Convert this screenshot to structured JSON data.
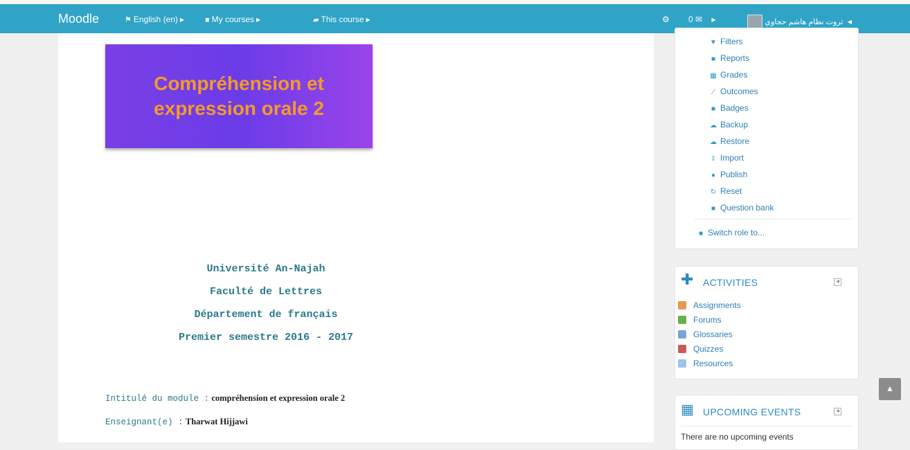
{
  "navbar": {
    "brand": "Moodle",
    "language": "English (en)",
    "my_courses": "My courses",
    "this_course": "This course",
    "messages_count": "0",
    "user_name": "ثروت نظام هاشم حجاوي"
  },
  "banner": {
    "line1": "Compréhension et",
    "line2": "expression orale 2"
  },
  "header_lines": [
    "Université An-Najah",
    "Faculté de Lettres",
    "Département de français",
    "Premier semestre  2016 - 2017"
  ],
  "info": {
    "module_label": "Intitulé du module :",
    "module_value": "compréhension et expression orale 2",
    "teacher_label": "Enseignant(e) :",
    "teacher_value": "Tharwat Hijjawi"
  },
  "admin": {
    "items": [
      {
        "label": "Filters",
        "icon": "filter-icon"
      },
      {
        "label": "Reports",
        "icon": "folder-icon"
      },
      {
        "label": "Grades",
        "icon": "table-icon"
      },
      {
        "label": "Outcomes",
        "icon": "magic-icon"
      },
      {
        "label": "Badges",
        "icon": "folder-icon"
      },
      {
        "label": "Backup",
        "icon": "cloud-upload-icon"
      },
      {
        "label": "Restore",
        "icon": "cloud-upload-icon"
      },
      {
        "label": "Import",
        "icon": "upload-icon"
      },
      {
        "label": "Publish",
        "icon": "globe-icon"
      },
      {
        "label": "Reset",
        "icon": "refresh-icon"
      },
      {
        "label": "Question bank",
        "icon": "folder-icon"
      }
    ],
    "switch_role": "Switch role to..."
  },
  "activities": {
    "title": "ACTIVITIES",
    "items": [
      {
        "label": "Assignments",
        "color": "#e59a4e"
      },
      {
        "label": "Forums",
        "color": "#6ab04c"
      },
      {
        "label": "Glossaries",
        "color": "#7aa3d8"
      },
      {
        "label": "Quizzes",
        "color": "#c85b5b"
      },
      {
        "label": "Resources",
        "color": "#9ec4e8"
      }
    ]
  },
  "events": {
    "title": "UPCOMING EVENTS",
    "empty_text": "There are no upcoming events"
  },
  "colors": {
    "navbar": "#2fa4c7",
    "banner_text": "#f39a2a",
    "banner_bg": "#7b3fe6",
    "teal_text": "#2b7a8c",
    "link": "#2f7fb3"
  }
}
